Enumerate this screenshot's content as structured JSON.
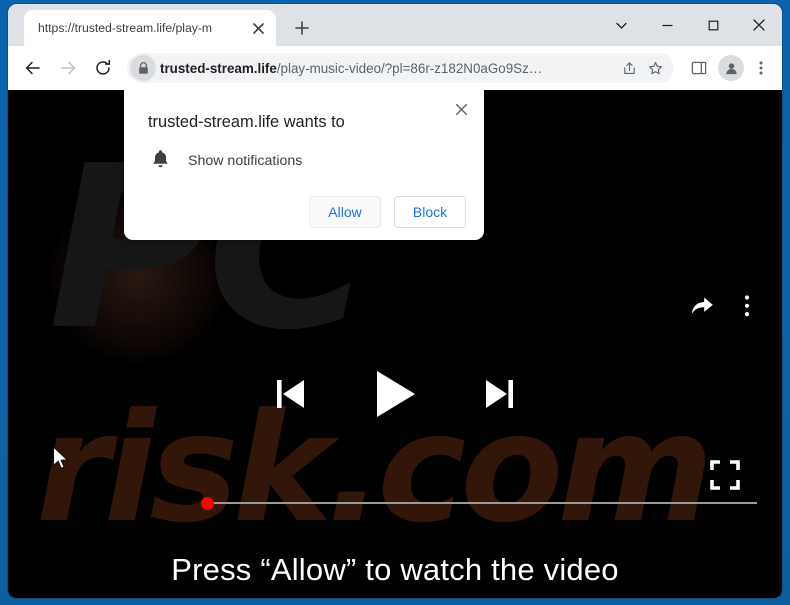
{
  "window": {
    "controls": [
      {
        "name": "tab-search",
        "label": "⌄"
      },
      {
        "name": "minimize",
        "label": "–"
      },
      {
        "name": "maximize",
        "label": "□"
      },
      {
        "name": "close",
        "label": "✕"
      }
    ]
  },
  "tabstrip": {
    "tab_title": "https://trusted-stream.life/play-m",
    "close_label": "✕",
    "new_tab_label": "+"
  },
  "toolbar": {
    "back_label": "←",
    "forward_label": "→",
    "reload_label": "⟳",
    "url_bold": "trusted-stream.life",
    "url_rest": "/play-music-video/?pl=86r-z182N0aGo9Sz…",
    "lock_icon": "padlock-icon",
    "share_icon": "share-icon",
    "bookmark_icon": "star-icon",
    "side_panel_icon": "side-panel-icon",
    "profile_icon": "profile-avatar-icon",
    "menu_icon": "three-dot-menu-icon"
  },
  "permission_bubble": {
    "title": "trusted-stream.life wants to",
    "option_label": "Show notifications",
    "option_icon": "bell-icon",
    "close_label": "✕",
    "allow_label": "Allow",
    "block_label": "Block",
    "accent_color": "#1a73e8"
  },
  "page": {
    "cta_text": "Press “Allow” to watch the video",
    "background_color": "#000000",
    "watermark_top": "PC",
    "watermark_bottom": "risk.com",
    "player": {
      "previous_icon": "skip-previous-icon",
      "play_icon": "play-icon",
      "next_icon": "skip-next-icon",
      "share_icon": "share-arrow-icon",
      "more_icon": "three-dot-menu-icon",
      "fullscreen_icon": "fullscreen-icon",
      "progress_value": 0,
      "progress_color": "#ff0000",
      "track_color": "#9a9a9a"
    }
  }
}
